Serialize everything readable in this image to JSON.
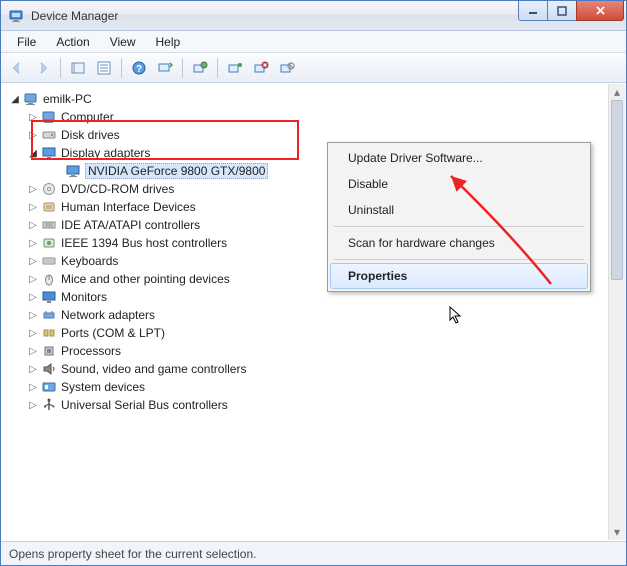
{
  "window": {
    "title": "Device Manager"
  },
  "menubar": {
    "items": [
      "File",
      "Action",
      "View",
      "Help"
    ]
  },
  "tree": {
    "root": "emilk-PC",
    "items": [
      {
        "label": "Computer",
        "icon": "computer"
      },
      {
        "label": "Disk drives",
        "icon": "disk"
      },
      {
        "label": "Display adapters",
        "icon": "display",
        "expanded": true,
        "children": [
          {
            "label": "NVIDIA GeForce 9800 GTX/9800",
            "icon": "display",
            "selected": true
          }
        ]
      },
      {
        "label": "DVD/CD-ROM drives",
        "icon": "dvd"
      },
      {
        "label": "Human Interface Devices",
        "icon": "hid"
      },
      {
        "label": "IDE ATA/ATAPI controllers",
        "icon": "ide"
      },
      {
        "label": "IEEE 1394 Bus host controllers",
        "icon": "ieee"
      },
      {
        "label": "Keyboards",
        "icon": "keyboard"
      },
      {
        "label": "Mice and other pointing devices",
        "icon": "mouse"
      },
      {
        "label": "Monitors",
        "icon": "monitor"
      },
      {
        "label": "Network adapters",
        "icon": "network"
      },
      {
        "label": "Ports (COM & LPT)",
        "icon": "ports"
      },
      {
        "label": "Processors",
        "icon": "cpu"
      },
      {
        "label": "Sound, video and game controllers",
        "icon": "sound"
      },
      {
        "label": "System devices",
        "icon": "system"
      },
      {
        "label": "Universal Serial Bus controllers",
        "icon": "usb"
      }
    ]
  },
  "context_menu": {
    "items": [
      {
        "label": "Update Driver Software...",
        "type": "item"
      },
      {
        "label": "Disable",
        "type": "item"
      },
      {
        "label": "Uninstall",
        "type": "item"
      },
      {
        "type": "sep"
      },
      {
        "label": "Scan for hardware changes",
        "type": "item"
      },
      {
        "type": "sep"
      },
      {
        "label": "Properties",
        "type": "item",
        "hovered": true
      }
    ]
  },
  "statusbar": {
    "text": "Opens property sheet for the current selection."
  }
}
